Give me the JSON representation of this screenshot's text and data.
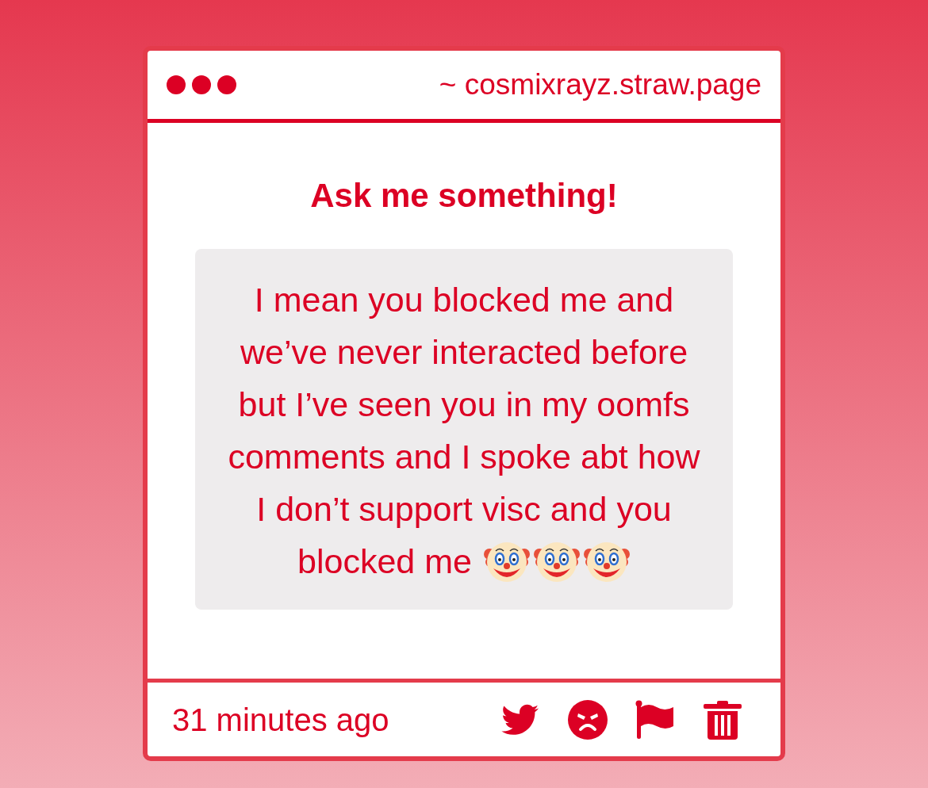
{
  "header": {
    "url": "~ cosmixrayz.straw.page"
  },
  "prompt": {
    "title": "Ask me something!"
  },
  "question": {
    "text": "I mean you blocked me and we’ve never interacted before but I’ve seen you in my oomfs comments and I spoke abt how I don’t support visc and you blocked me"
  },
  "footer": {
    "time": "31 minutes ago"
  }
}
